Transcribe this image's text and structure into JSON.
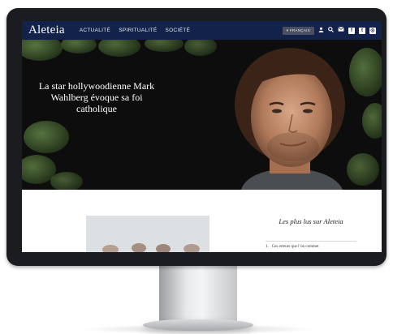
{
  "site": {
    "logo": "Aleteia",
    "nav": [
      "ACTUALITÉ",
      "SPIRITUALITÉ",
      "SOCIÉTÉ"
    ],
    "language_button": "▾ FRANÇAIS",
    "header_icons": [
      "user-icon",
      "search-icon",
      "mail-icon"
    ],
    "social": [
      {
        "label": "f",
        "icon": "facebook-icon"
      },
      {
        "label": "t",
        "icon": "twitter-icon"
      },
      {
        "label": "◎",
        "icon": "instagram-icon"
      }
    ]
  },
  "hero": {
    "headline": "La star hollywoodienne Mark Wahlberg évoque sa foi catholique"
  },
  "sidebar": {
    "title": "Les plus lus sur Aleteia",
    "items": [
      {
        "number": "1.",
        "text": "Ces erreurs que l’on commet"
      }
    ]
  },
  "colors": {
    "header_bg": "#13224a",
    "hero_bg": "#0c0d0c",
    "monitor_bezel": "#1b1c1f"
  }
}
